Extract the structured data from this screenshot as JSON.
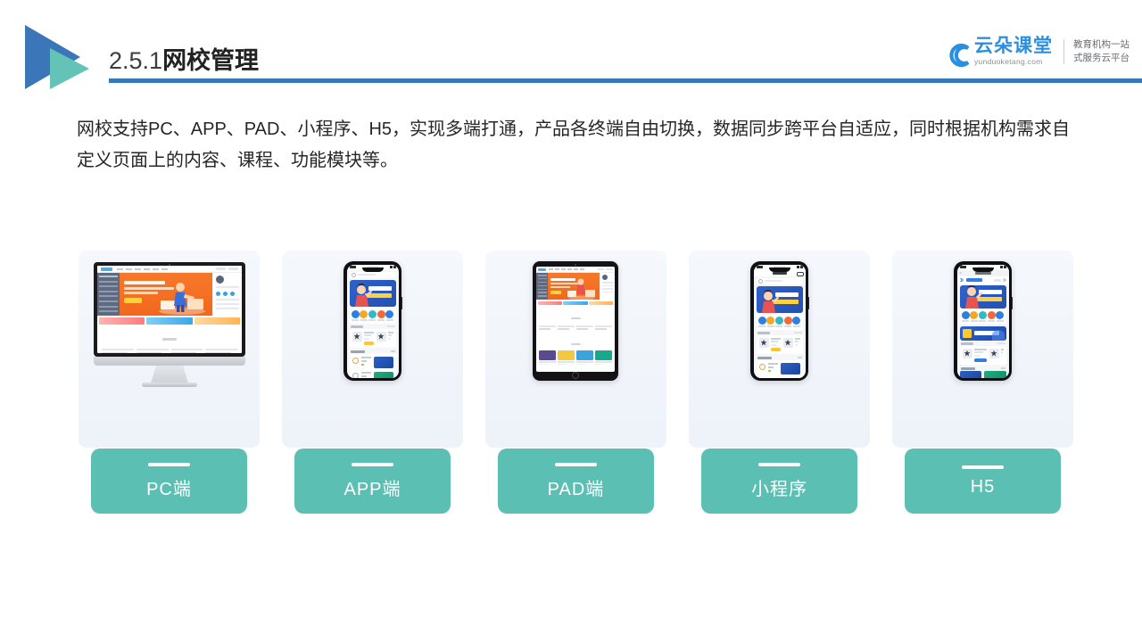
{
  "header": {
    "number": "2.5.1",
    "title_cn": "网校管理",
    "logo_icon": "triangle-play-logo"
  },
  "brand": {
    "cloud_icon": "cloud-icon",
    "name_cn": "云朵课堂",
    "name_en": "yunduoketang.com",
    "tagline_line1": "教育机构一站",
    "tagline_line2": "式服务云平台",
    "accent_color": "#2b8fe0"
  },
  "body": {
    "paragraph": "网校支持PC、APP、PAD、小程序、H5，实现多端打通，产品各终端自由切换，数据同步跨平台自适应，同时根据机构需求自定义页面上的内容、课程、功能模块等。"
  },
  "cards": [
    {
      "label": "PC端",
      "device": "desktop-monitor",
      "device_icon": "desktop-icon"
    },
    {
      "label": "APP端",
      "device": "smartphone",
      "device_icon": "phone-icon"
    },
    {
      "label": "PAD端",
      "device": "tablet",
      "device_icon": "tablet-icon"
    },
    {
      "label": "小程序",
      "device": "smartphone-miniprogram",
      "device_icon": "phone-icon"
    },
    {
      "label": "H5",
      "device": "smartphone-h5",
      "device_icon": "phone-icon"
    }
  ],
  "colors": {
    "label_button": "#5bbfb4",
    "title_rule": "#3579bb",
    "logo_blue": "#3b76b8",
    "logo_teal": "#63c3b6",
    "card_background": "#eef2f9"
  }
}
